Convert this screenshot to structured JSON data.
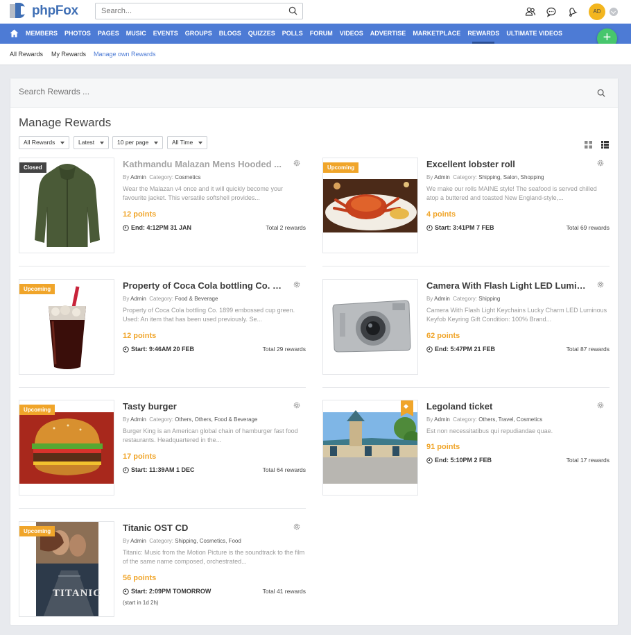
{
  "header": {
    "logo_text": "phpFox",
    "search_placeholder": "Search...",
    "avatar_initials": "AD",
    "icons": [
      "friends-icon",
      "chat-icon",
      "bell-icon"
    ]
  },
  "nav": {
    "items": [
      "MEMBERS",
      "PHOTOS",
      "PAGES",
      "MUSIC",
      "EVENTS",
      "GROUPS",
      "BLOGS",
      "QUIZZES",
      "POLLS",
      "FORUM",
      "VIDEOS",
      "ADVERTISE",
      "MARKETPLACE",
      "REWARDS",
      "ULTIMATE VIDEOS"
    ],
    "active": "REWARDS",
    "fab_label": "+"
  },
  "subnav": {
    "all_rewards": "All Rewards",
    "my_rewards": "My Rewards",
    "manage_own": "Manage own Rewards"
  },
  "main": {
    "search_placeholder": "Search Rewards ...",
    "title": "Manage Rewards",
    "filters": [
      "All Rewards",
      "Latest",
      "10 per page",
      "All Time"
    ]
  },
  "labels": {
    "by": "By",
    "category": "Category:"
  },
  "colors": {
    "nav_blue": "#4d7bd5",
    "accent_orange": "#f0a52a",
    "fab_green": "#47c66d",
    "avatar_yellow": "#f3b61f"
  },
  "rewards": [
    {
      "title": "Kathmandu Malazan Mens Hooded ...",
      "badge": "Closed",
      "author": "Admin",
      "categories": "Cosmetics",
      "description": "Wear the Malazan v4 once and it will quickly become your favourite jacket. This versatile softshell provides...",
      "points": "12 points",
      "time_label": "End: 4:12PM 31 JAN",
      "total": "Total 2 rewards",
      "image": "green-hooded-jacket"
    },
    {
      "title": "Excellent lobster roll",
      "badge": "Upcoming",
      "author": "Admin",
      "categories": "Shipping, Salon, Shopping",
      "description": "We make our rolls MAINE style! The seafood is served chilled atop a buttered and toasted New England-style,...",
      "points": "4 points",
      "time_label": "Start: 3:41PM 7 FEB",
      "total": "Total 69 rewards",
      "image": "crab-on-plate"
    },
    {
      "title": "Property of Coca Cola bottling Co. 1...",
      "badge": "Upcoming",
      "author": "Admin",
      "categories": "Food & Beverage",
      "description": "Property of Coca Cola bottling Co. 1899 embossed cup green. Used: An item that has been used previously. Se...",
      "points": "12 points",
      "time_label": "Start: 9:46AM 20 FEB",
      "total": "Total 29 rewards",
      "image": "cola-glass-with-straw"
    },
    {
      "title": "Camera With Flash Light LED Lumino...",
      "badge": "",
      "author": "Admin",
      "categories": "Shipping",
      "description": "Camera With Flash Light Keychains Lucky Charm LED Luminous Keyfob Keyring Gift Condition: 100% Brand...",
      "points": "62 points",
      "time_label": "End: 5:47PM 21 FEB",
      "total": "Total 87 rewards",
      "image": "silver-compact-camera"
    },
    {
      "title": "Tasty burger",
      "badge": "Upcoming",
      "author": "Admin",
      "categories": "Others, Others, Food & Beverage",
      "description": "Burger King is an American global chain of hamburger fast food restaurants. Headquartered in the...",
      "points": "17 points",
      "time_label": "Start: 11:39AM 1 DEC",
      "total": "Total 64 rewards",
      "image": "burger"
    },
    {
      "title": "Legoland ticket",
      "badge": "",
      "featured": true,
      "author": "Admin",
      "categories": "Others, Travel, Cosmetics",
      "description": "Est non necessitatibus qui repudiandae quae.",
      "points": "91 points",
      "time_label": "End: 5:10PM 2 FEB",
      "total": "Total 17 rewards",
      "image": "theme-park-entrance"
    },
    {
      "title": "Titanic OST CD",
      "badge": "Upcoming",
      "author": "Admin",
      "categories": "Shipping, Cosmetics, Food",
      "description": "Titanic: Music from the Motion Picture is the soundtrack to the film of the same name composed, orchestrated...",
      "points": "56 points",
      "time_label": "Start: 2:09PM TOMORROW",
      "sub_time": "(start in 1d 2h)",
      "total": "Total 41 rewards",
      "image": "titanic-poster",
      "poster_text": "TITANIC"
    }
  ]
}
